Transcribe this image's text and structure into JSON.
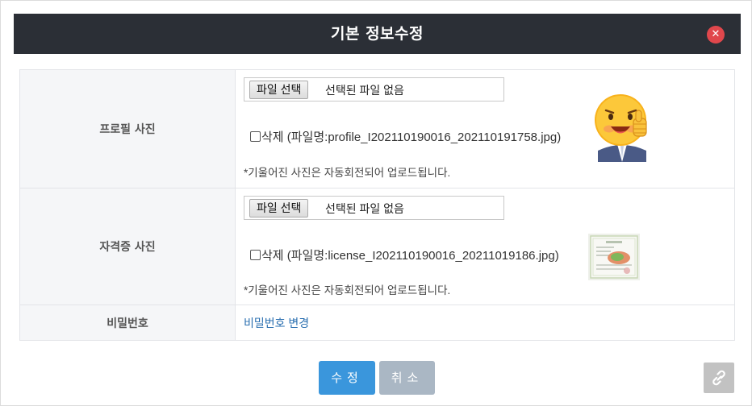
{
  "dialog": {
    "title": "기본 정보수정",
    "close_icon": "close-icon",
    "close_color": "#e0474c"
  },
  "profile": {
    "label": "프로필 사진",
    "file_button": "파일 선택",
    "file_status": "선택된 파일 없음",
    "delete_text": "삭제 (파일명:profile_I202110190016_202110191758.jpg)",
    "note": "*기울어진 사진은 자동회전되어 업로드됩니다.",
    "thumbnail": "smiley-thumbs-up-emoji"
  },
  "license": {
    "label": "자격증 사진",
    "file_button": "파일 선택",
    "file_status": "선택된 파일 없음",
    "delete_text": "삭제 (파일명:license_I202110190016_20211019186.jpg)",
    "note": "*기울어진 사진은 자동회전되어 업로드됩니다.",
    "thumbnail": "license-document"
  },
  "password": {
    "label": "비밀번호",
    "link": "비밀번호 변경"
  },
  "buttons": {
    "submit": "수정",
    "cancel": "취소",
    "submit_color": "#3a96dc",
    "cancel_color": "#aab7c4"
  },
  "corner": {
    "icon": "link-icon"
  }
}
